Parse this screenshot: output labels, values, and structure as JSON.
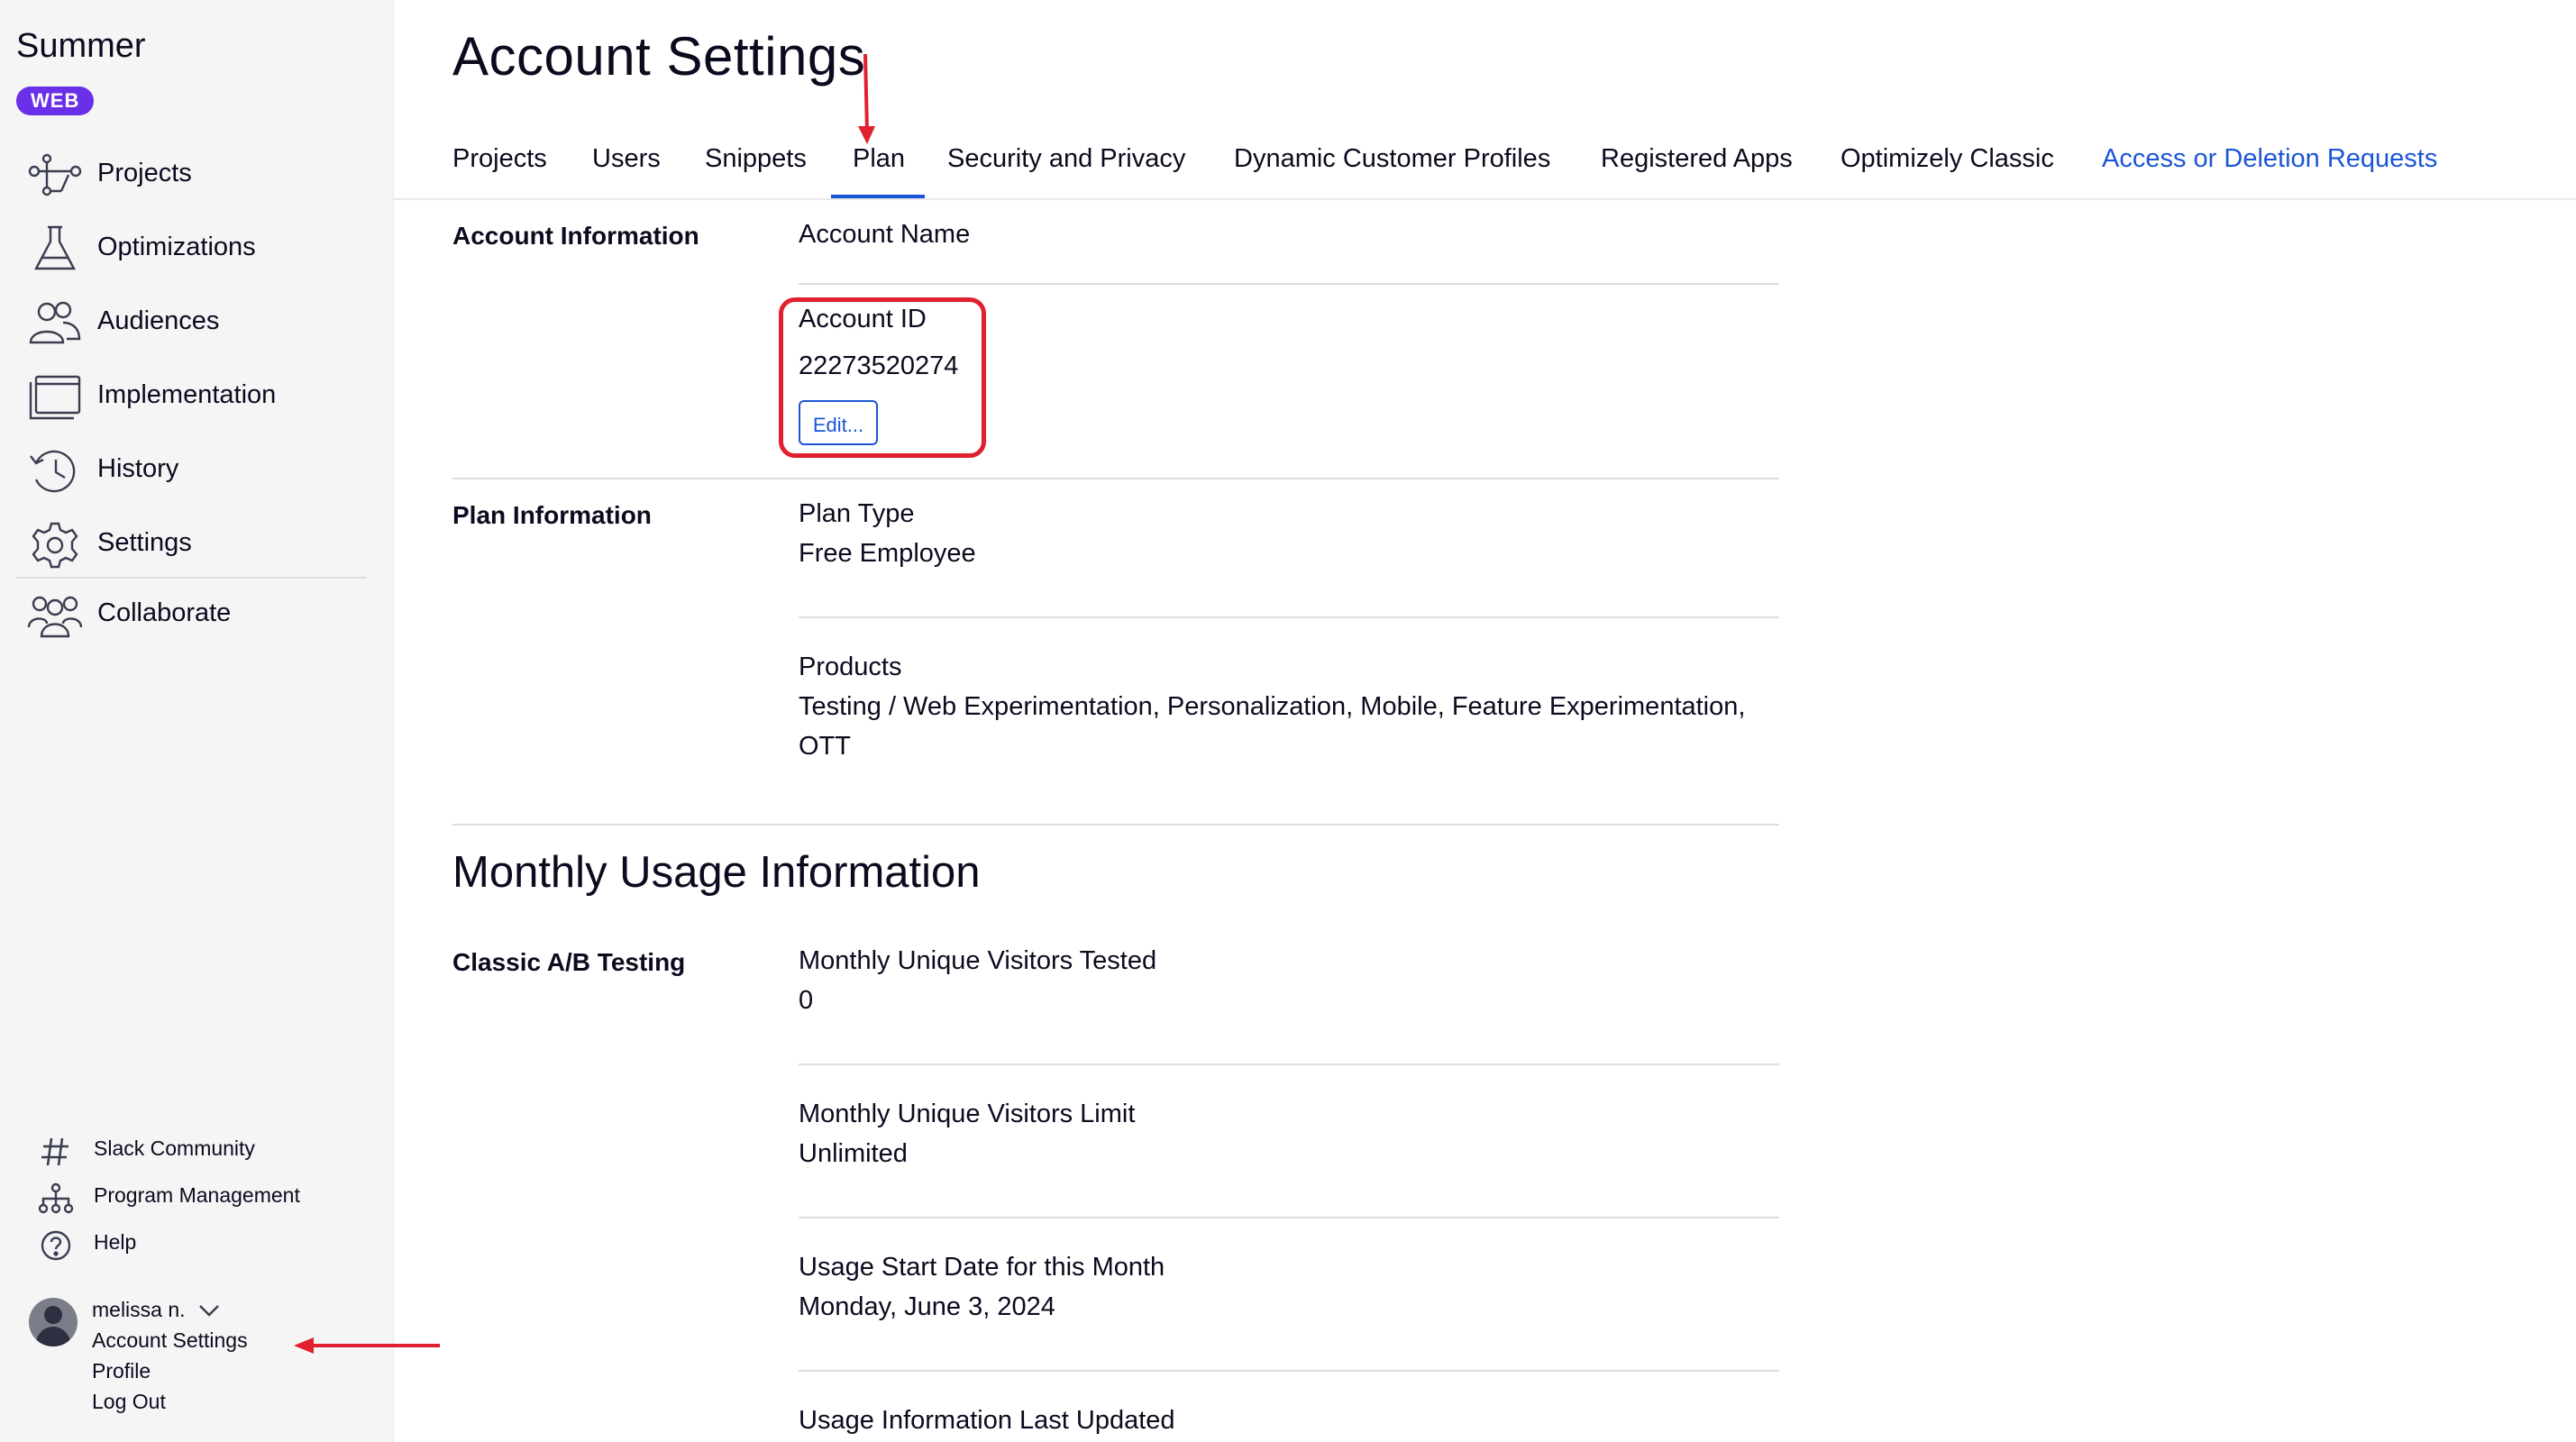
{
  "sidebar": {
    "brand": "Summer",
    "badge": "WEB",
    "nav": [
      {
        "label": "Projects",
        "icon": "projects-icon"
      },
      {
        "label": "Optimizations",
        "icon": "flask-icon"
      },
      {
        "label": "Audiences",
        "icon": "audiences-icon"
      },
      {
        "label": "Implementation",
        "icon": "implementation-icon"
      },
      {
        "label": "History",
        "icon": "history-icon"
      },
      {
        "label": "Settings",
        "icon": "gear-icon"
      }
    ],
    "collaborate": {
      "label": "Collaborate",
      "icon": "collaborate-icon"
    },
    "utility": [
      {
        "label": "Slack Community",
        "icon": "hash-icon"
      },
      {
        "label": "Program Management",
        "icon": "org-chart-icon"
      },
      {
        "label": "Help",
        "icon": "help-icon"
      }
    ],
    "user": {
      "name": "melissa n.",
      "links": [
        "Account Settings",
        "Profile",
        "Log Out"
      ]
    }
  },
  "main": {
    "title": "Account Settings",
    "tabs": [
      "Projects",
      "Users",
      "Snippets",
      "Plan",
      "Security and Privacy",
      "Dynamic Customer Profiles",
      "Registered Apps",
      "Optimizely Classic",
      "Access or Deletion Requests"
    ],
    "active_tab": "Plan",
    "account_information": {
      "label": "Account Information",
      "account_name_label": "Account Name",
      "account_id_label": "Account ID",
      "account_id_value": "22273520274",
      "edit_button": "Edit..."
    },
    "plan_information": {
      "label": "Plan Information",
      "plan_type_label": "Plan Type",
      "plan_type_value": "Free Employee",
      "products_label": "Products",
      "products_line1": "Testing / Web Experimentation, Personalization, Mobile, Feature Experimentation,",
      "products_line2": "OTT"
    },
    "monthly_usage": {
      "title": "Monthly Usage Information",
      "classic_label": "Classic A/B Testing",
      "visitors_tested_label": "Monthly Unique Visitors Tested",
      "visitors_tested_value": "0",
      "visitors_limit_label": "Monthly Unique Visitors Limit",
      "visitors_limit_value": "Unlimited",
      "start_date_label": "Usage Start Date for this Month",
      "start_date_value": "Monday, June 3, 2024",
      "last_updated_label": "Usage Information Last Updated"
    }
  },
  "colors": {
    "accent": "#1b55d6",
    "badge": "#6a2fe8",
    "annotation": "#e0202e"
  }
}
